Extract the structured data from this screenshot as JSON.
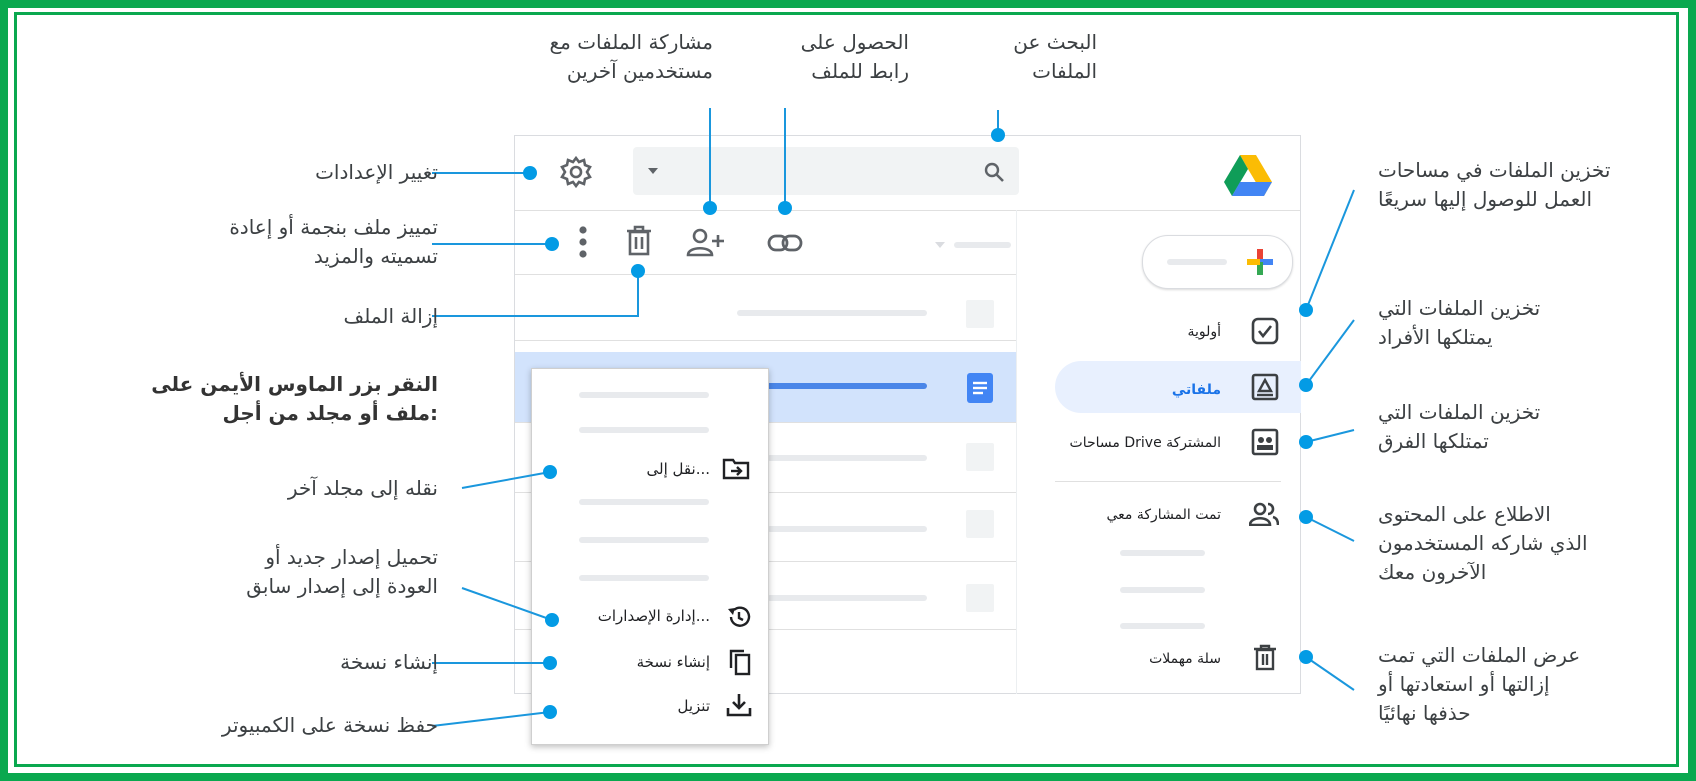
{
  "colors": {
    "frame": "#0aa84f",
    "callout": "#039be5",
    "line": "#1a97dd",
    "accent": "#1a73e8",
    "selected": "#d2e3fc"
  },
  "callouts": {
    "search_files": [
      "البحث عن",
      "الملفات"
    ],
    "get_link": [
      "الحصول على",
      "رابط للملف"
    ],
    "share_files": [
      "مشاركة الملفات مع",
      "مستخدمين آخرين"
    ],
    "change_settings": "تغيير الإعدادات",
    "star_rename": [
      "تمييز ملف بنجمة أو إعادة",
      "تسميته والمزيد"
    ],
    "remove_file": "إزالة الملف",
    "right_click": [
      "النقر بزر الماوس الأيمن على",
      "ملف أو مجلد من أجل:"
    ],
    "move_to_folder": "نقله إلى مجلد آخر",
    "upload_version": [
      "تحميل إصدار جديد أو",
      "العودة إلى إصدار سابق"
    ],
    "make_copy": "إنشاء نسخة",
    "save_copy": "حفظ نسخة على الكمبيوتر",
    "workspaces": [
      "تخزين الملفات في مساحات",
      "العمل للوصول إليها سريعًا"
    ],
    "individual_files": [
      "تخزين الملفات التي",
      "يمتلكها الأفراد"
    ],
    "team_files": [
      "تخزين الملفات التي",
      "تمتلكها الفرق"
    ],
    "shared_content": [
      "الاطلاع على المحتوى",
      "الذي شاركه المستخدمون",
      "الآخرون معك"
    ],
    "trash_view": [
      "عرض الملفات التي تمت",
      "إزالتها أو استعادتها أو",
      "حذفها نهائيًا"
    ]
  },
  "sidebar": {
    "priority": "أولوية",
    "my_drive": "ملفاتي",
    "shared_drives": "مساحات Drive المشتركة",
    "shared_with_me": "تمت المشاركة معي",
    "trash": "سلة مهملات"
  },
  "context_menu": {
    "move_to": "نقل إلى...",
    "manage_versions": "إدارة الإصدارات...",
    "make_copy": "إنشاء نسخة",
    "download": "تنزيل"
  },
  "icons": [
    "drive-logo-icon",
    "search-icon",
    "gear-icon",
    "more-vert-icon",
    "trash-icon",
    "add-person-icon",
    "link-icon",
    "plus-icon",
    "checkbox-icon",
    "drive-folder-icon",
    "shared-drives-icon",
    "people-icon",
    "doc-icon",
    "move-icon",
    "history-icon",
    "copy-icon",
    "download-icon",
    "dropdown-icon"
  ]
}
